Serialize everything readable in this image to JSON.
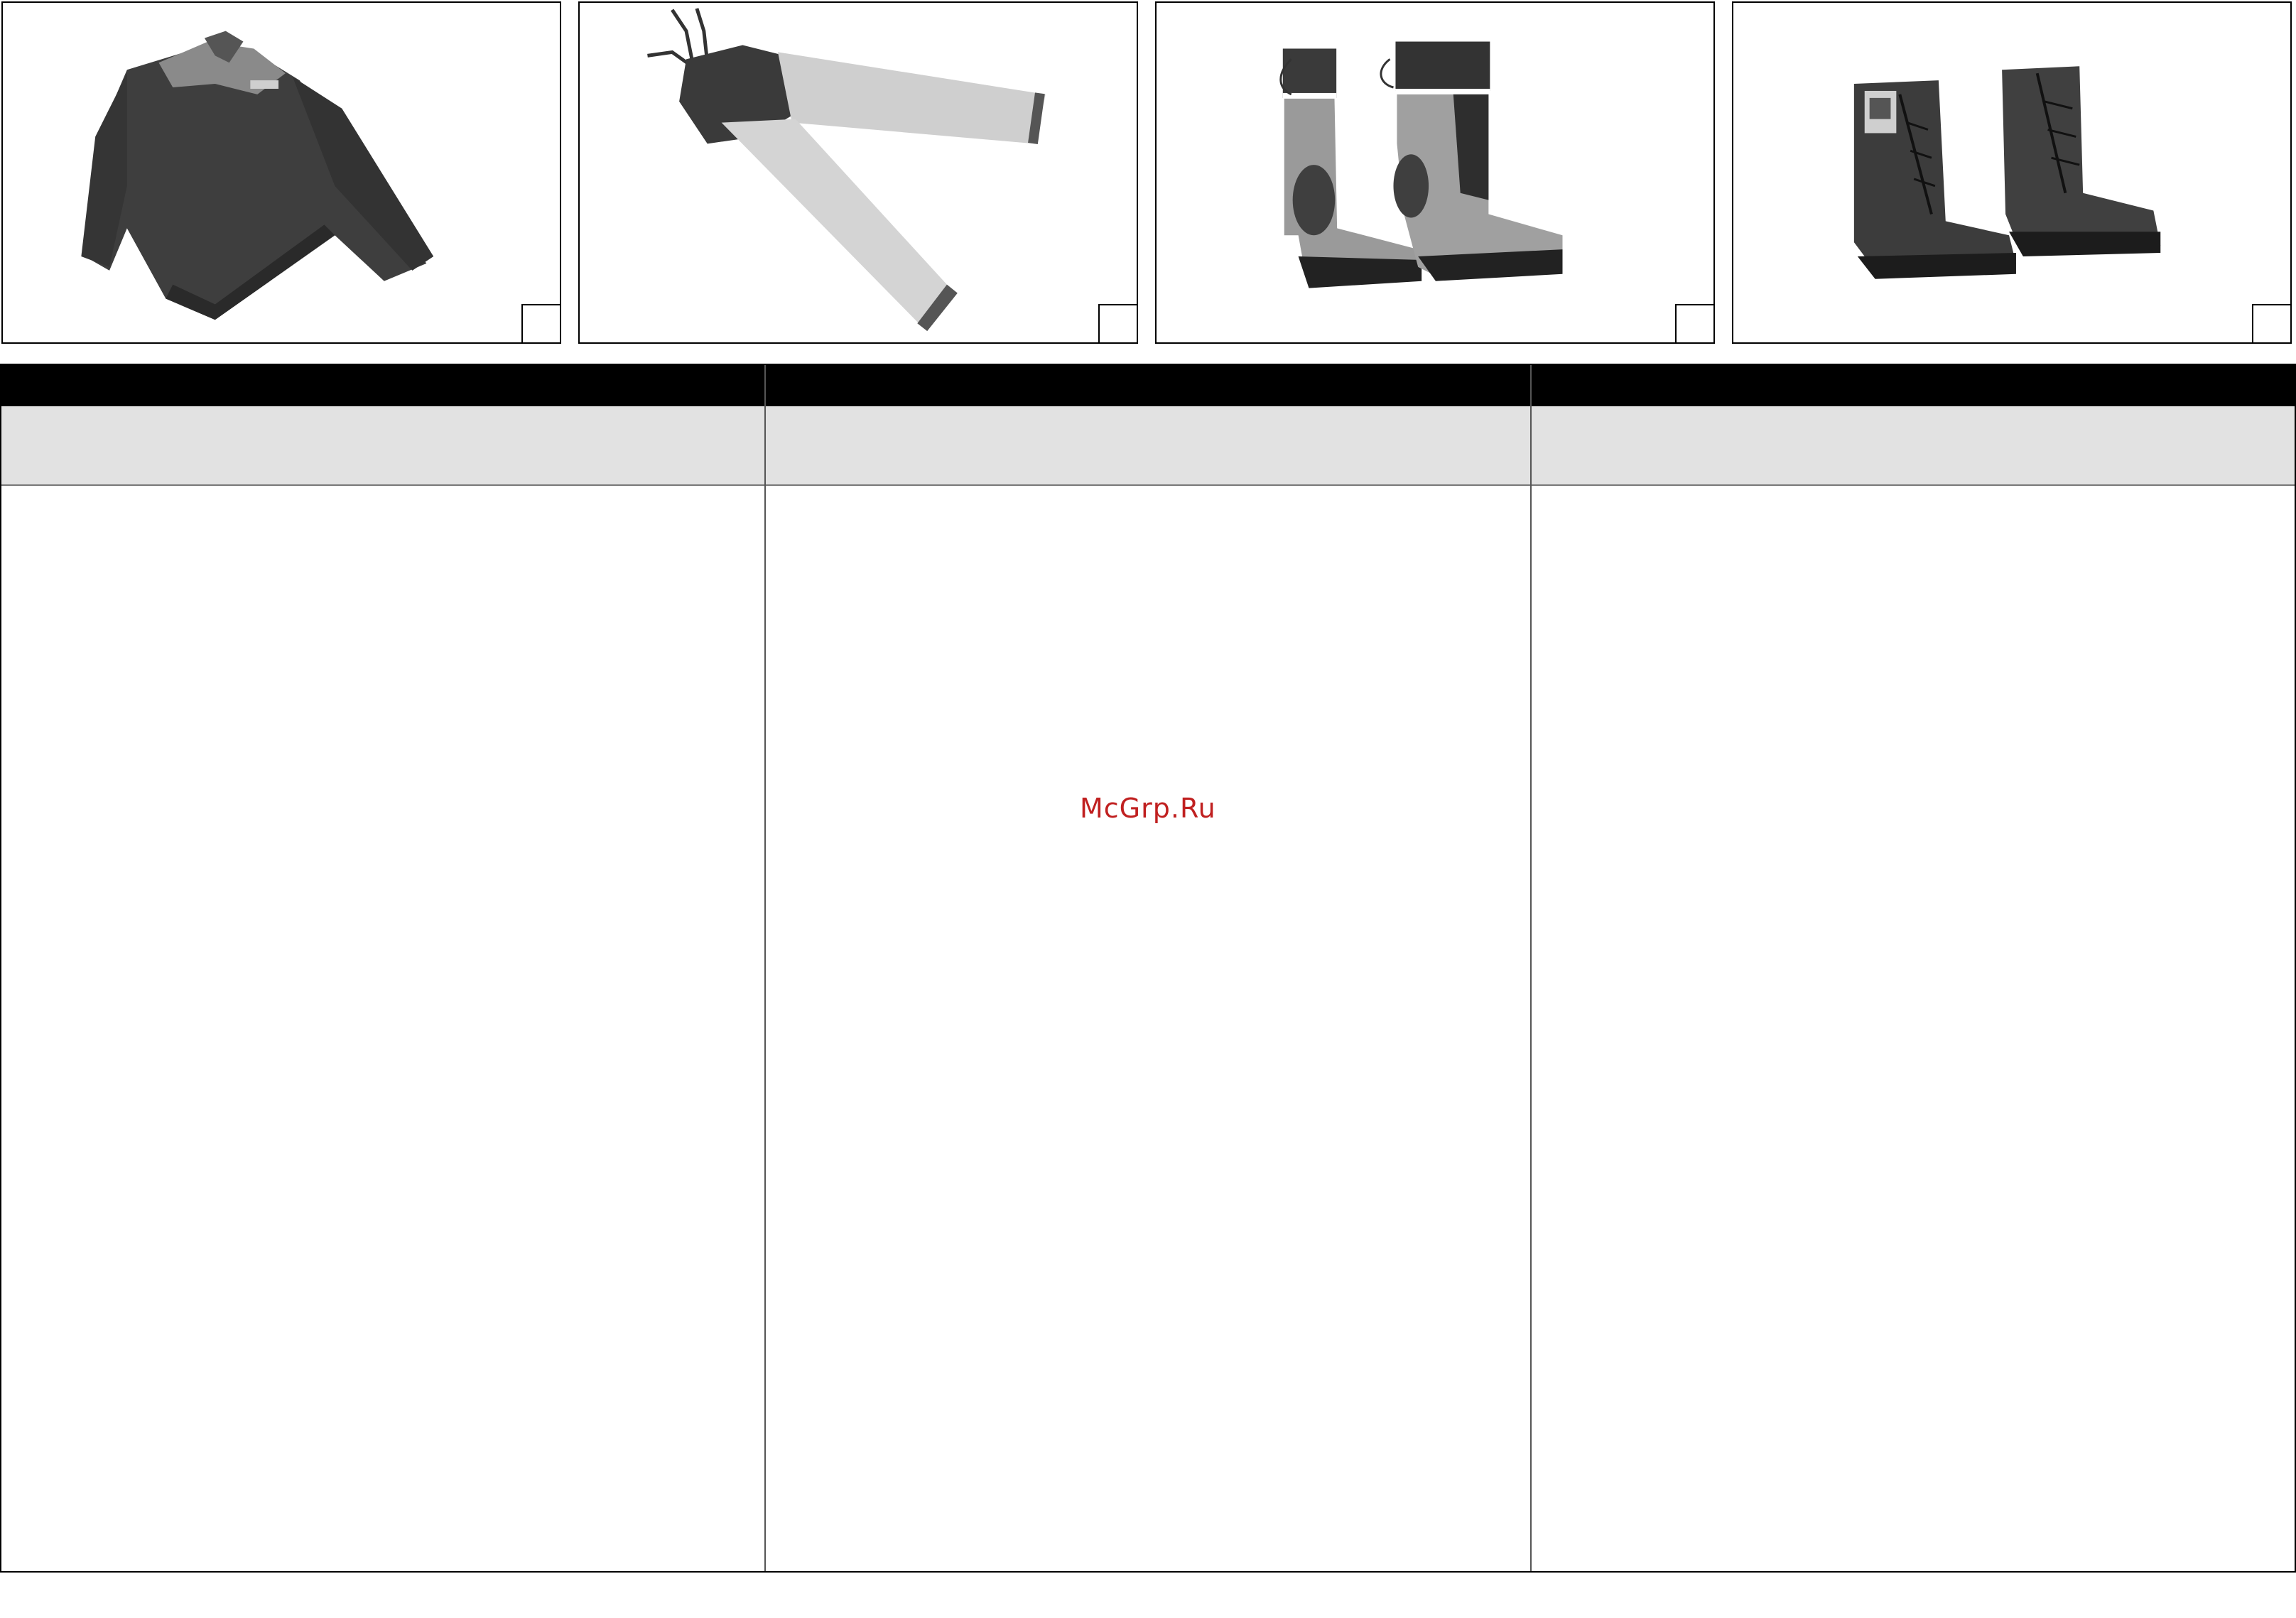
{
  "photos": [
    {
      "id": "jacket",
      "caption": "",
      "number": ""
    },
    {
      "id": "trousers",
      "caption": "",
      "number": ""
    },
    {
      "id": "rubber-boots",
      "caption": "",
      "number": ""
    },
    {
      "id": "leather-boots",
      "caption": "",
      "number": ""
    }
  ],
  "table": {
    "columns": [
      {
        "header": "",
        "subheader": "",
        "body": ""
      },
      {
        "header": "",
        "subheader": "",
        "body": ""
      },
      {
        "header": "",
        "subheader": "",
        "body": ""
      }
    ]
  },
  "watermark": {
    "text": "McGrp.Ru",
    "color": "#c02020"
  }
}
